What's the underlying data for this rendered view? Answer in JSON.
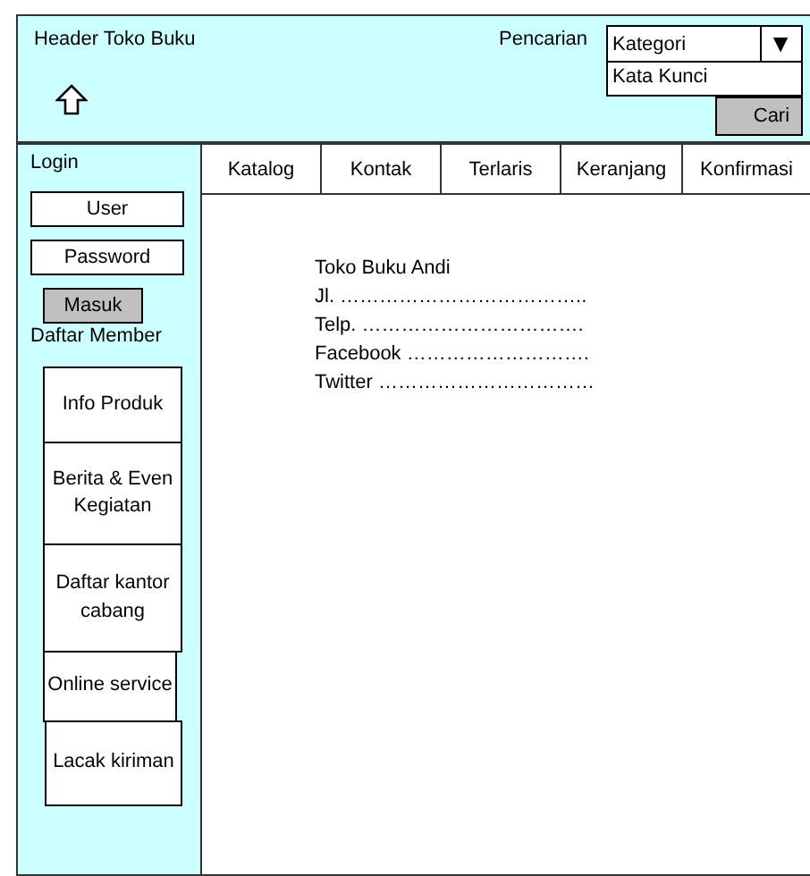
{
  "header": {
    "title": "Header Toko Buku",
    "search_label": "Pencarian",
    "category": {
      "value": "Kategori",
      "arrow": "▼"
    },
    "keyword": {
      "value": "Kata Kunci"
    },
    "search_button": "Cari"
  },
  "sidebar": {
    "title": "Login",
    "user": {
      "value": "User"
    },
    "password": {
      "value": "Password"
    },
    "login_button": "Masuk",
    "register_link": "Daftar Member",
    "menu": [
      {
        "label": "Info Produk"
      },
      {
        "label": "Berita & Even Kegiatan"
      },
      {
        "label": "Daftar kantor cabang"
      },
      {
        "label": "Online service"
      },
      {
        "label": "Lacak kiriman"
      }
    ]
  },
  "tabs": [
    {
      "label": "Katalog"
    },
    {
      "label": "Kontak"
    },
    {
      "label": "Terlaris"
    },
    {
      "label": "Keranjang"
    },
    {
      "label": "Konfirmasi"
    }
  ],
  "contact": [
    "Toko Buku Andi",
    "Jl. ………………………………..",
    "Telp. …………………………….",
    "Facebook ……………………….",
    "Twitter ……………………………"
  ]
}
